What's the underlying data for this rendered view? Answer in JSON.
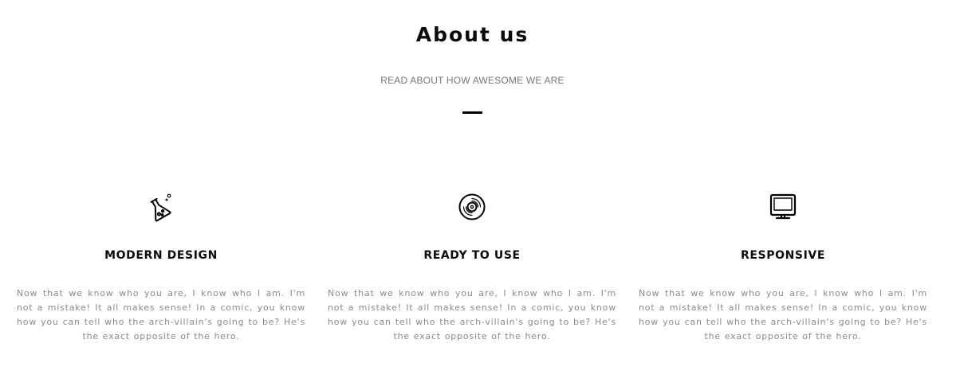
{
  "section": {
    "title": "About us",
    "subtitle": "READ ABOUT HOW AWESOME WE ARE"
  },
  "features": [
    {
      "icon": "flask-icon",
      "heading": "MODERN DESIGN",
      "text": "Now that we know who you are, I know who I am. I'm not a mistake! It all makes sense! In a comic, you know how you can tell who the arch-villain's going to be? He's the exact opposite of the hero."
    },
    {
      "icon": "vinyl-disc-icon",
      "heading": "READY TO USE",
      "text": "Now that we know who you are, I know who I am. I'm not a mistake! It all makes sense! In a comic, you know how you can tell who the arch-villain's going to be? He's the exact opposite of the hero."
    },
    {
      "icon": "monitor-icon",
      "heading": "RESPONSIVE",
      "text": "Now that we know who you are, I know who I am. I'm not a mistake! It all makes sense! In a comic, you know how you can tell who the arch-villain's going to be? He's the exact opposite of the hero."
    }
  ]
}
